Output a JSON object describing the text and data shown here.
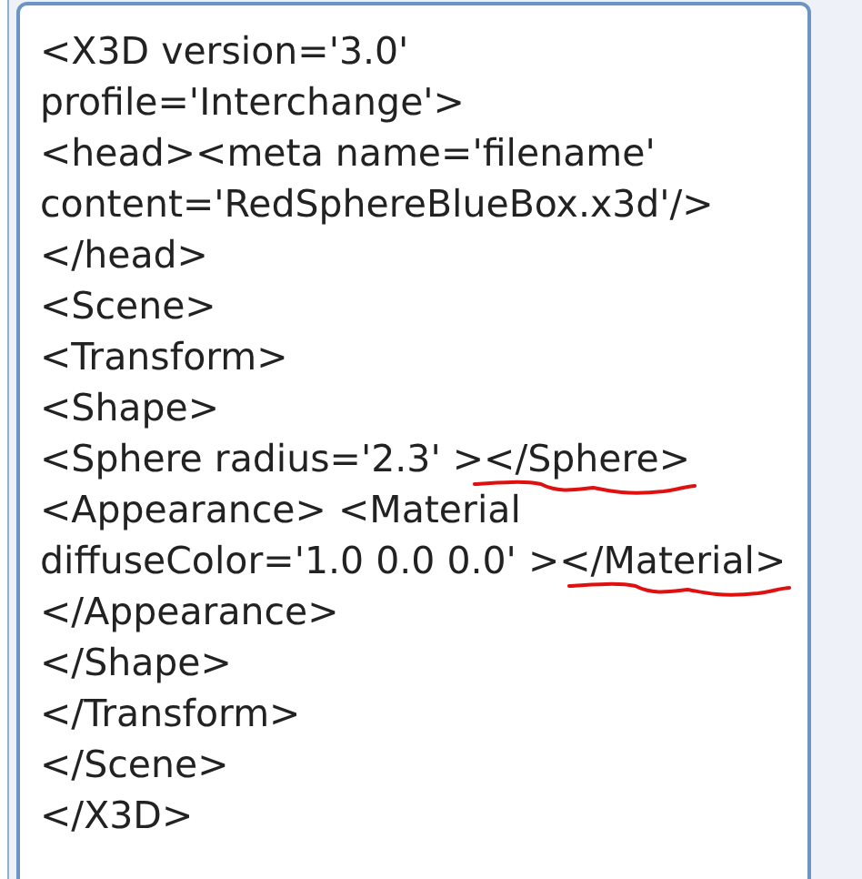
{
  "editor": {
    "lines": [
      {
        "text": "<X3D version='3.0'",
        "underlined": false
      },
      {
        "text": "profile='Interchange'>",
        "underlined": false
      },
      {
        "text": "<head><meta name='filename'",
        "underlined": false
      },
      {
        "text": "content='RedSphereBlueBox.x3d'/>",
        "underlined": false
      },
      {
        "text": "</head>",
        "underlined": false
      },
      {
        "text": "<Scene>",
        "underlined": false
      },
      {
        "text": "<Transform>",
        "underlined": false
      },
      {
        "text": "<Shape>",
        "underlined": false
      },
      {
        "text": "<Sphere radius='2.3' ></Sphere>",
        "underlined": true
      },
      {
        "text": "<Appearance> <Material",
        "underlined": false
      },
      {
        "text": "diffuseColor='1.0 0.0 0.0' ></Material>",
        "underlined": true
      },
      {
        "text": "</Appearance>",
        "underlined": false
      },
      {
        "text": "</Shape>",
        "underlined": false
      },
      {
        "text": "</Transform>",
        "underlined": false
      },
      {
        "text": "</Scene>",
        "underlined": false
      },
      {
        "text": "</X3D>",
        "underlined": false
      }
    ]
  }
}
